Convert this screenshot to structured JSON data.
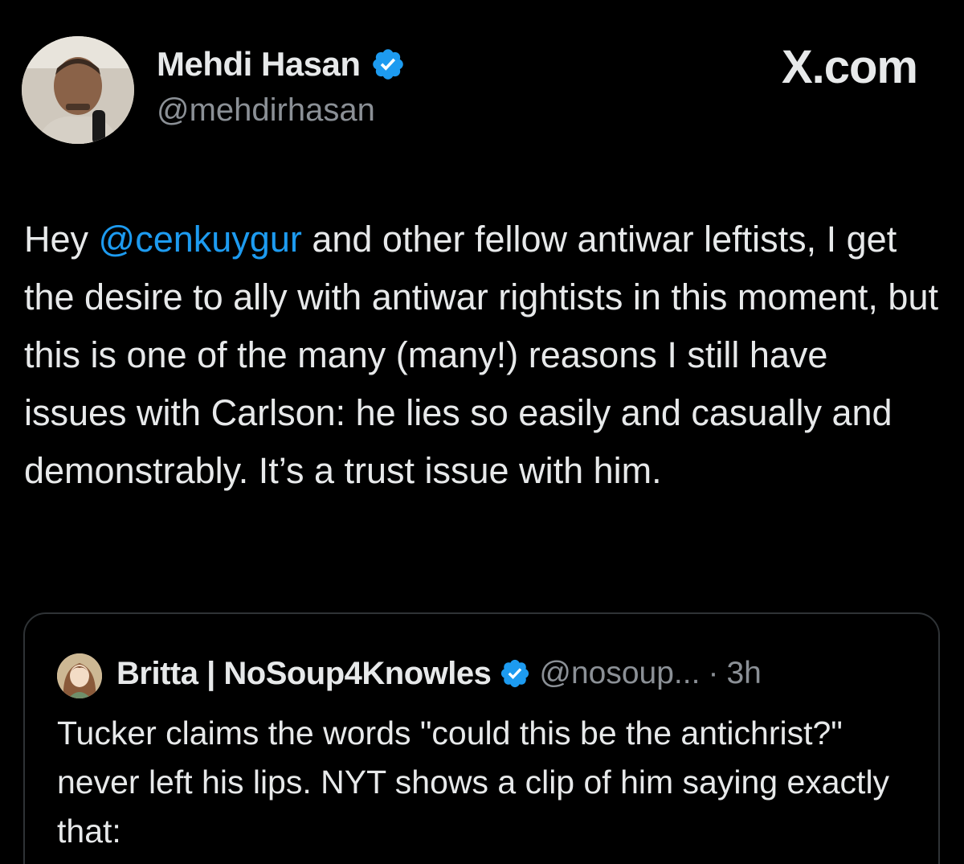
{
  "post": {
    "author_name": "Mehdi Hasan",
    "author_handle": "@mehdirhasan",
    "brand": "X.com",
    "text_before_mention": "Hey ",
    "mention": "@cenkuygur",
    "text_after_mention": " and other fellow antiwar leftists, I get the desire to ally with antiwar rightists in this moment, but this is one of the many (many!) reasons I still have issues with Carlson: he lies so easily and casually and demonstrably. It’s a trust issue with him."
  },
  "quoted": {
    "author_name": "Britta | NoSoup4Knowles",
    "author_handle": "@nosoup...",
    "separator": "·",
    "time": "3h",
    "text": "Tucker claims the words \"could this be the antichrist?\" never left his lips. NYT shows a clip of him saying exactly that:"
  },
  "colors": {
    "background": "#000000",
    "text": "#e7e9ea",
    "secondary_text": "#8b9096",
    "mention": "#1d9bf0",
    "verified_badge": "#1d9bf0",
    "card_border": "#2f3336"
  },
  "icons": {
    "verified": "verified-badge-icon",
    "brand_logo": "x-logo"
  }
}
